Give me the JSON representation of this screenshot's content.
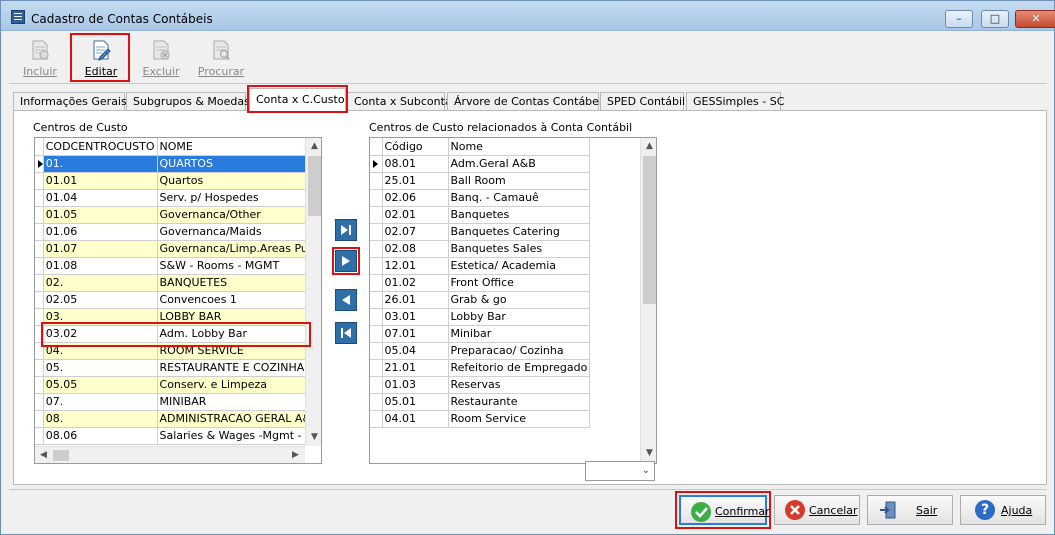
{
  "window": {
    "title": "Cadastro de Contas Contábeis",
    "controls": {
      "minimize": "–",
      "maximize": "□",
      "close": "✕"
    }
  },
  "toolbar": {
    "buttons": [
      {
        "label": "Incluir",
        "icon": "new-document-icon",
        "enabled": false
      },
      {
        "label": "Editar",
        "icon": "edit-document-icon",
        "enabled": true
      },
      {
        "label": "Excluir",
        "icon": "delete-document-icon",
        "enabled": false
      },
      {
        "label": "Procurar",
        "icon": "search-document-icon",
        "enabled": false
      }
    ]
  },
  "tabs": [
    {
      "label": "Informações Gerais"
    },
    {
      "label": "Subgrupos & Moedas"
    },
    {
      "label": "Conta x C.Custo",
      "selected": true
    },
    {
      "label": "Conta x Subconta"
    },
    {
      "label": "Árvore de Contas Contábeis"
    },
    {
      "label": "SPED Contábil"
    },
    {
      "label": "GESSimples - SC"
    }
  ],
  "left_panel": {
    "label": "Centros de Custo",
    "columns": [
      "CODCENTROCUSTO",
      "NOME"
    ],
    "rows": [
      [
        "01.",
        "QUARTOS"
      ],
      [
        "01.01",
        "Quartos"
      ],
      [
        "01.04",
        "Serv. p/ Hospedes"
      ],
      [
        "01.05",
        "Governanca/Other"
      ],
      [
        "01.06",
        "Governanca/Maids"
      ],
      [
        "01.07",
        "Governanca/Limp.Areas Publ"
      ],
      [
        "01.08",
        "S&W - Rooms - MGMT"
      ],
      [
        "02.",
        "BANQUETES"
      ],
      [
        "02.05",
        "Convencoes 1"
      ],
      [
        "03.",
        "LOBBY BAR"
      ],
      [
        "03.02",
        "Adm. Lobby Bar"
      ],
      [
        "04.",
        "ROOM SERVICE"
      ],
      [
        "05.",
        "RESTAURANTE E COZINHA"
      ],
      [
        "05.05",
        "Conserv. e Limpeza"
      ],
      [
        "07.",
        "MINIBAR"
      ],
      [
        "08.",
        "ADMINISTRACAO GERAL A&E"
      ],
      [
        "08.06",
        "Salaries & Wages -Mgmt - Pr"
      ]
    ]
  },
  "right_panel": {
    "label": "Centros de Custo relacionados à Conta Contábil",
    "columns": [
      "Código",
      "Nome"
    ],
    "rows": [
      [
        "08.01",
        "Adm.Geral A&B"
      ],
      [
        "25.01",
        "Ball Room"
      ],
      [
        "02.06",
        "Banq. - Camauê"
      ],
      [
        "02.01",
        "Banquetes"
      ],
      [
        "02.07",
        "Banquetes Catering"
      ],
      [
        "02.08",
        "Banquetes Sales"
      ],
      [
        "12.01",
        "Estetica/ Academia"
      ],
      [
        "01.02",
        "Front Office"
      ],
      [
        "26.01",
        "Grab & go"
      ],
      [
        "03.01",
        "Lobby Bar"
      ],
      [
        "07.01",
        "Minibar"
      ],
      [
        "05.04",
        "Preparacao/ Cozinha"
      ],
      [
        "21.01",
        "Refeitorio de Empregado"
      ],
      [
        "01.03",
        "Reservas"
      ],
      [
        "05.01",
        "Restaurante"
      ],
      [
        "04.01",
        "Room Service"
      ]
    ]
  },
  "move_buttons": [
    "add-all-icon",
    "add-one-icon",
    "remove-one-icon",
    "remove-all-icon"
  ],
  "footer": {
    "confirm": "Confirmar",
    "cancel": "Cancelar",
    "exit": "Sair",
    "help": "Ajuda"
  },
  "colors": {
    "selection": "#2a7bde",
    "highlight_row": "#ffffcc",
    "annotation": "#dd1111"
  }
}
